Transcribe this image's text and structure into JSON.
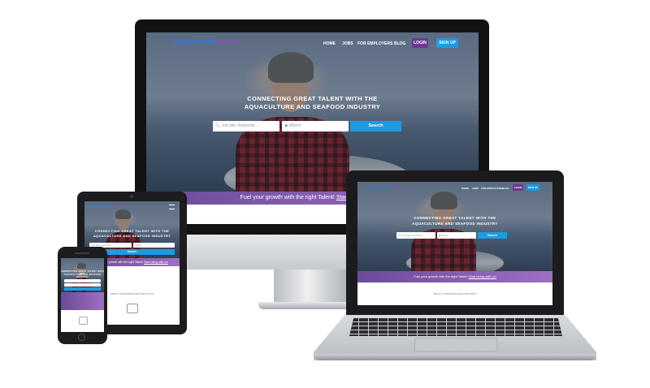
{
  "site": {
    "logo_part1": "AQUACULTURE",
    "logo_part2": "TALENT",
    "nav": {
      "home": "HOME",
      "jobs": "JOBS",
      "employers": "FOR EMPLOYERS",
      "blog": "BLOG",
      "login": "LOGIN",
      "signup": "SIGN UP"
    },
    "hero_line1": "CONNECTING GREAT TALENT WITH THE",
    "hero_line2": "AQUACULTURE AND SEAFOOD INDUSTRY",
    "search": {
      "job_placeholder": "Job title, keywords...",
      "where_placeholder": "Where",
      "button": "Search"
    },
    "banner_text": "Fuel your growth with the right Talent!",
    "banner_link": "Start hiring with us!",
    "companies_heading": "ABOUT COMPANIES WE WORK WITH"
  },
  "icons": {
    "search": "search-icon",
    "location": "map-pin-icon",
    "menu": "hamburger-menu-icon"
  },
  "colors": {
    "accent_blue": "#1e9ae0",
    "accent_purple": "#6b3a8f",
    "banner_purple": "#8a5cb3",
    "device_black": "#1c1c1e",
    "device_silver": "#c9ccd0"
  }
}
